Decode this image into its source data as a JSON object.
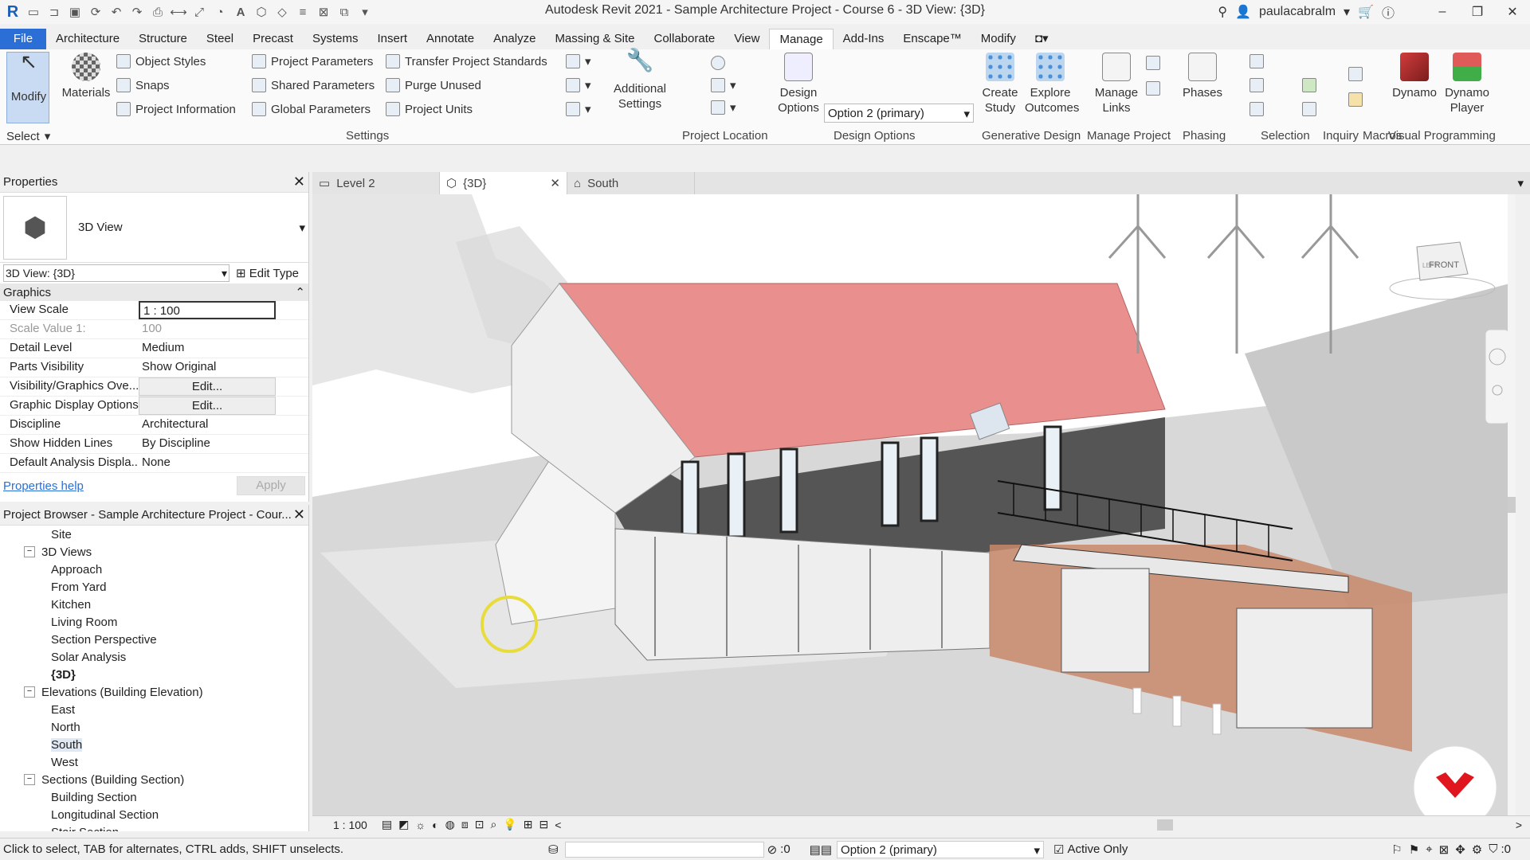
{
  "app": {
    "title": "Autodesk Revit 2021 - Sample Architecture Project - Course 6 - 3D View: {3D}",
    "user": "paulacabralm"
  },
  "tabs": [
    "File",
    "Architecture",
    "Structure",
    "Steel",
    "Precast",
    "Systems",
    "Insert",
    "Annotate",
    "Analyze",
    "Massing & Site",
    "Collaborate",
    "View",
    "Manage",
    "Add-Ins",
    "Enscape™",
    "Modify"
  ],
  "active_tab": "Manage",
  "ribbon": {
    "modify": "Modify",
    "select": "Select",
    "materials": "Materials",
    "settings_items": [
      "Object Styles",
      "Snaps",
      "Project Information",
      "Project Parameters",
      "Shared Parameters",
      "Global Parameters",
      "Transfer Project Standards",
      "Purge Unused",
      "Project Units"
    ],
    "additional_settings": "Additional Settings",
    "design_options": "Design Options",
    "design_option_value": "Option 2 (primary)",
    "create_study": "Create Study",
    "explore_outcomes": "Explore Outcomes",
    "manage_links": "Manage Links",
    "phases": "Phases",
    "dynamo": "Dynamo",
    "dynamo_player": "Dynamo Player",
    "panels": [
      "Select",
      "Settings",
      "Project Location",
      "Design Options",
      "Generative Design",
      "Manage Project",
      "Phasing",
      "Selection",
      "Inquiry",
      "Macros",
      "Visual Programming"
    ]
  },
  "properties": {
    "title": "Properties",
    "type_name": "3D View",
    "view_selector": "3D View: {3D}",
    "edit_type": "Edit Type",
    "group": "Graphics",
    "rows": [
      {
        "k": "View Scale",
        "v": "1 : 100"
      },
      {
        "k": "Scale Value    1:",
        "v": "100"
      },
      {
        "k": "Detail Level",
        "v": "Medium"
      },
      {
        "k": "Parts Visibility",
        "v": "Show Original"
      },
      {
        "k": "Visibility/Graphics Ove...",
        "v": "Edit..."
      },
      {
        "k": "Graphic Display Options",
        "v": "Edit..."
      },
      {
        "k": "Discipline",
        "v": "Architectural"
      },
      {
        "k": "Show Hidden Lines",
        "v": "By Discipline"
      },
      {
        "k": "Default Analysis Displa...",
        "v": "None"
      }
    ],
    "help": "Properties help",
    "apply": "Apply"
  },
  "browser": {
    "title": "Project Browser - Sample Architecture Project - Cour...",
    "items": [
      {
        "t": "Site",
        "d": 2,
        "tgl": ""
      },
      {
        "t": "3D Views",
        "d": 1,
        "tgl": "−"
      },
      {
        "t": "Approach",
        "d": 2,
        "tgl": ""
      },
      {
        "t": "From Yard",
        "d": 2,
        "tgl": ""
      },
      {
        "t": "Kitchen",
        "d": 2,
        "tgl": ""
      },
      {
        "t": "Living Room",
        "d": 2,
        "tgl": ""
      },
      {
        "t": "Section Perspective",
        "d": 2,
        "tgl": ""
      },
      {
        "t": "Solar Analysis",
        "d": 2,
        "tgl": ""
      },
      {
        "t": "{3D}",
        "d": 2,
        "tgl": "",
        "b": true
      },
      {
        "t": "Elevations (Building Elevation)",
        "d": 1,
        "tgl": "−"
      },
      {
        "t": "East",
        "d": 2,
        "tgl": ""
      },
      {
        "t": "North",
        "d": 2,
        "tgl": ""
      },
      {
        "t": "South",
        "d": 2,
        "tgl": "",
        "s": true
      },
      {
        "t": "West",
        "d": 2,
        "tgl": ""
      },
      {
        "t": "Sections (Building Section)",
        "d": 1,
        "tgl": "−"
      },
      {
        "t": "Building Section",
        "d": 2,
        "tgl": ""
      },
      {
        "t": "Longitudinal Section",
        "d": 2,
        "tgl": ""
      },
      {
        "t": "Stair Section",
        "d": 2,
        "tgl": ""
      }
    ]
  },
  "view_tabs": [
    "Level 2",
    "{3D}",
    "South"
  ],
  "viewcube": {
    "front": "FRONT",
    "left": "LEFT"
  },
  "viewbar": {
    "scale": "1 : 100"
  },
  "status": {
    "hint": "Click to select, TAB for alternates, CTRL adds, SHIFT unselects.",
    "worksets": ":0",
    "design_option": "Option 2 (primary)",
    "active_only": "Active Only",
    "filter": ":0"
  },
  "colors": {
    "roof": "#e9908e",
    "facade": "#555555",
    "cladding": "#c98a6c",
    "file_tab": "#2b6fd6"
  }
}
